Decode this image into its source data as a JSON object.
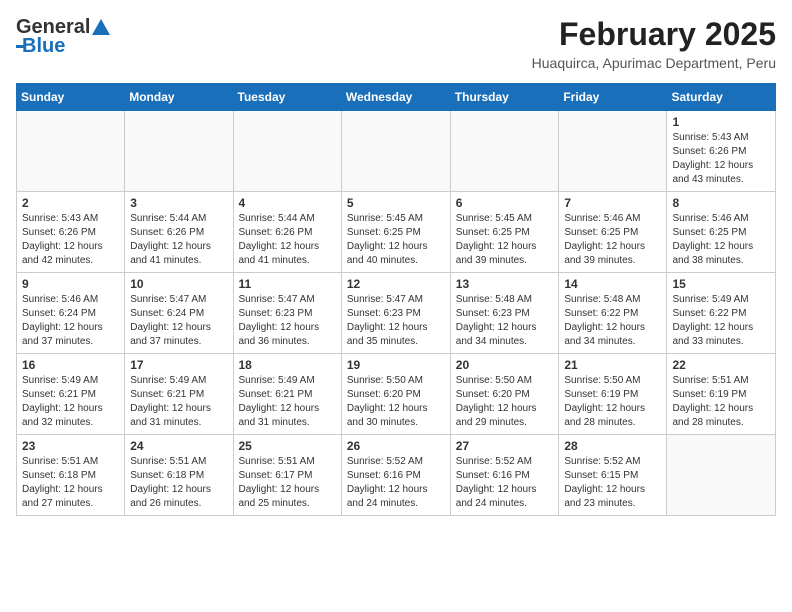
{
  "header": {
    "logo_general": "General",
    "logo_blue": "Blue",
    "month_title": "February 2025",
    "location": "Huaquirca, Apurimac Department, Peru"
  },
  "weekdays": [
    "Sunday",
    "Monday",
    "Tuesday",
    "Wednesday",
    "Thursday",
    "Friday",
    "Saturday"
  ],
  "weeks": [
    [
      {
        "day": "",
        "info": ""
      },
      {
        "day": "",
        "info": ""
      },
      {
        "day": "",
        "info": ""
      },
      {
        "day": "",
        "info": ""
      },
      {
        "day": "",
        "info": ""
      },
      {
        "day": "",
        "info": ""
      },
      {
        "day": "1",
        "info": "Sunrise: 5:43 AM\nSunset: 6:26 PM\nDaylight: 12 hours and 43 minutes."
      }
    ],
    [
      {
        "day": "2",
        "info": "Sunrise: 5:43 AM\nSunset: 6:26 PM\nDaylight: 12 hours and 42 minutes."
      },
      {
        "day": "3",
        "info": "Sunrise: 5:44 AM\nSunset: 6:26 PM\nDaylight: 12 hours and 41 minutes."
      },
      {
        "day": "4",
        "info": "Sunrise: 5:44 AM\nSunset: 6:26 PM\nDaylight: 12 hours and 41 minutes."
      },
      {
        "day": "5",
        "info": "Sunrise: 5:45 AM\nSunset: 6:25 PM\nDaylight: 12 hours and 40 minutes."
      },
      {
        "day": "6",
        "info": "Sunrise: 5:45 AM\nSunset: 6:25 PM\nDaylight: 12 hours and 39 minutes."
      },
      {
        "day": "7",
        "info": "Sunrise: 5:46 AM\nSunset: 6:25 PM\nDaylight: 12 hours and 39 minutes."
      },
      {
        "day": "8",
        "info": "Sunrise: 5:46 AM\nSunset: 6:25 PM\nDaylight: 12 hours and 38 minutes."
      }
    ],
    [
      {
        "day": "9",
        "info": "Sunrise: 5:46 AM\nSunset: 6:24 PM\nDaylight: 12 hours and 37 minutes."
      },
      {
        "day": "10",
        "info": "Sunrise: 5:47 AM\nSunset: 6:24 PM\nDaylight: 12 hours and 37 minutes."
      },
      {
        "day": "11",
        "info": "Sunrise: 5:47 AM\nSunset: 6:23 PM\nDaylight: 12 hours and 36 minutes."
      },
      {
        "day": "12",
        "info": "Sunrise: 5:47 AM\nSunset: 6:23 PM\nDaylight: 12 hours and 35 minutes."
      },
      {
        "day": "13",
        "info": "Sunrise: 5:48 AM\nSunset: 6:23 PM\nDaylight: 12 hours and 34 minutes."
      },
      {
        "day": "14",
        "info": "Sunrise: 5:48 AM\nSunset: 6:22 PM\nDaylight: 12 hours and 34 minutes."
      },
      {
        "day": "15",
        "info": "Sunrise: 5:49 AM\nSunset: 6:22 PM\nDaylight: 12 hours and 33 minutes."
      }
    ],
    [
      {
        "day": "16",
        "info": "Sunrise: 5:49 AM\nSunset: 6:21 PM\nDaylight: 12 hours and 32 minutes."
      },
      {
        "day": "17",
        "info": "Sunrise: 5:49 AM\nSunset: 6:21 PM\nDaylight: 12 hours and 31 minutes."
      },
      {
        "day": "18",
        "info": "Sunrise: 5:49 AM\nSunset: 6:21 PM\nDaylight: 12 hours and 31 minutes."
      },
      {
        "day": "19",
        "info": "Sunrise: 5:50 AM\nSunset: 6:20 PM\nDaylight: 12 hours and 30 minutes."
      },
      {
        "day": "20",
        "info": "Sunrise: 5:50 AM\nSunset: 6:20 PM\nDaylight: 12 hours and 29 minutes."
      },
      {
        "day": "21",
        "info": "Sunrise: 5:50 AM\nSunset: 6:19 PM\nDaylight: 12 hours and 28 minutes."
      },
      {
        "day": "22",
        "info": "Sunrise: 5:51 AM\nSunset: 6:19 PM\nDaylight: 12 hours and 28 minutes."
      }
    ],
    [
      {
        "day": "23",
        "info": "Sunrise: 5:51 AM\nSunset: 6:18 PM\nDaylight: 12 hours and 27 minutes."
      },
      {
        "day": "24",
        "info": "Sunrise: 5:51 AM\nSunset: 6:18 PM\nDaylight: 12 hours and 26 minutes."
      },
      {
        "day": "25",
        "info": "Sunrise: 5:51 AM\nSunset: 6:17 PM\nDaylight: 12 hours and 25 minutes."
      },
      {
        "day": "26",
        "info": "Sunrise: 5:52 AM\nSunset: 6:16 PM\nDaylight: 12 hours and 24 minutes."
      },
      {
        "day": "27",
        "info": "Sunrise: 5:52 AM\nSunset: 6:16 PM\nDaylight: 12 hours and 24 minutes."
      },
      {
        "day": "28",
        "info": "Sunrise: 5:52 AM\nSunset: 6:15 PM\nDaylight: 12 hours and 23 minutes."
      },
      {
        "day": "",
        "info": ""
      }
    ]
  ]
}
